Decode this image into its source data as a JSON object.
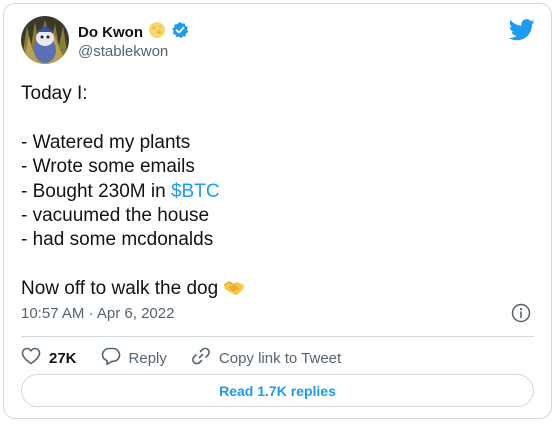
{
  "author": {
    "name": "Do Kwon",
    "handle": "@stablekwon",
    "name_emoji_icon": "moon-emoji-icon",
    "verified_icon": "verified-badge-icon"
  },
  "brand": {
    "icon": "twitter-bird-icon",
    "color": "#1d9bf0"
  },
  "tweet": {
    "lines": [
      "Today I:",
      "",
      "- Watered my plants",
      "- Wrote some emails",
      "- Bought 230M in ",
      "- vacuumed the house",
      "- had some mcdonalds",
      "",
      "Now off to walk the dog "
    ],
    "cashtag": "$BTC",
    "end_emoji_icon": "handshake-emoji-icon",
    "timestamp": "10:57 AM · Apr 6, 2022"
  },
  "actions": {
    "like_count": "27K",
    "reply_label": "Reply",
    "copy_label": "Copy link to Tweet"
  },
  "read_replies_label": "Read 1.7K replies",
  "colors": {
    "text": "#0f1419",
    "secondary": "#536471",
    "border": "#cfd9de",
    "link": "#1d9bf0"
  }
}
